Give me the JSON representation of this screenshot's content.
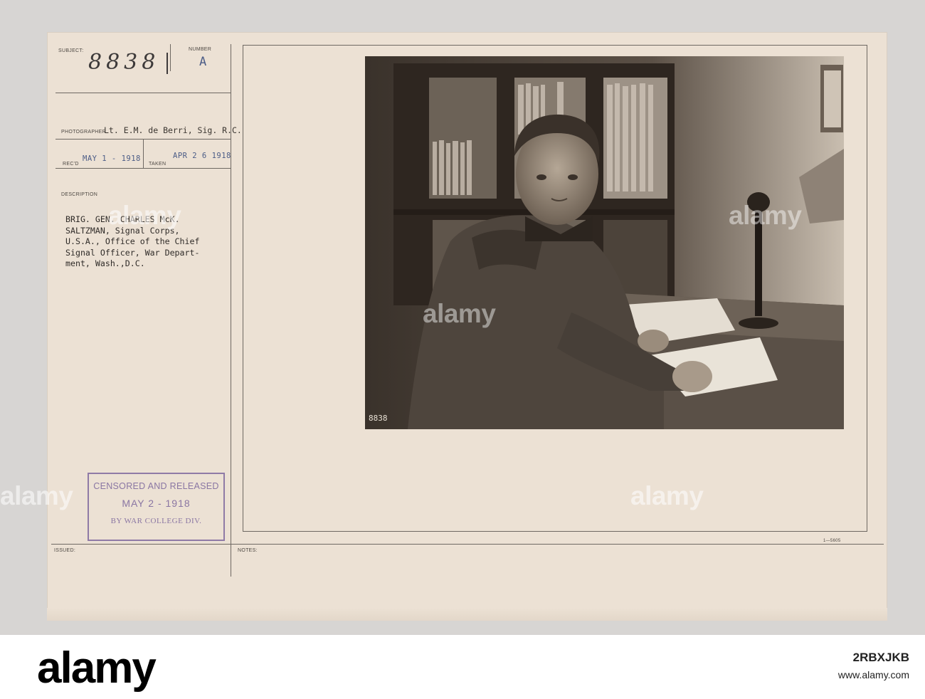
{
  "card": {
    "subject_label": "SUBJECT:",
    "subject_number": "8838",
    "number_label": "NUMBER",
    "number_value": "A",
    "photographer_label": "PHOTOGRAPHER",
    "photographer_value": "Lt. E.M. de Berri, Sig. R.C.",
    "recd_label": "REC'D",
    "recd_value": "MAY 1 - 1918",
    "taken_label": "TAKEN",
    "taken_value": "APR 2 6 1918",
    "description_label": "DESCRIPTION",
    "description_lines": [
      "BRIG. GEN. CHARLES McK.",
      "SALTZMAN, Signal Corps,",
      "U.S.A., Office of the Chief",
      "Signal Officer, War Depart-",
      "ment, Wash.,D.C."
    ],
    "censor_stamp": {
      "line1": "CENSORED AND RELEASED",
      "line2": "MAY 2 - 1918",
      "line3": "BY WAR COLLEGE DIV."
    },
    "issued_label": "ISSUED:",
    "notes_label": "NOTES:",
    "form_number": "1—5605",
    "photo_caption": "8838"
  },
  "watermark": "alamy",
  "footer": {
    "logo": "alamy",
    "image_id": "2RBXJKB",
    "site": "www.alamy.com"
  }
}
